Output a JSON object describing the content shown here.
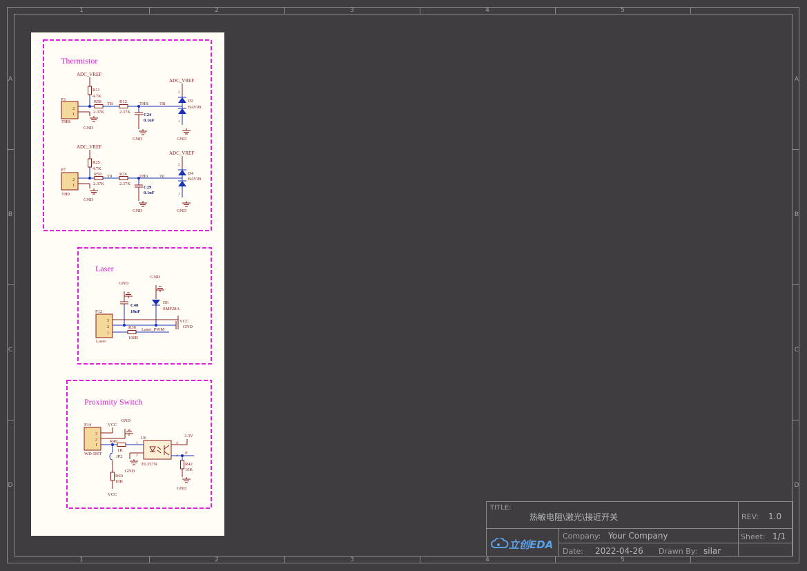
{
  "zones": {
    "columns": [
      "1",
      "2",
      "3",
      "4",
      "5"
    ],
    "rows": [
      "A",
      "B",
      "C",
      "D"
    ]
  },
  "sections": {
    "thermistor": "Thermistor",
    "laser": "Laser",
    "proximity": "Proximity Switch"
  },
  "thermistor": {
    "vref": "ADC_VREF",
    "gnd": "GND",
    "ch_b": {
      "connector_ref": "P3",
      "connector_name": "THB",
      "pins": [
        "2",
        "1"
      ],
      "r_pull_ref": "R11",
      "r_pull_val": "4.7K",
      "r_a_ref": "R58",
      "r_a_val": "2.37K",
      "net_a": "TB",
      "r_b_ref": "R12",
      "r_b_val": "2.37K",
      "net_b": "THB",
      "cap_ref": "C24",
      "cap_val": "0.1uF",
      "diode_net": "TB",
      "diode_ref": "D2",
      "diode_val": "BAV99",
      "diode_pins": [
        "2",
        "1"
      ]
    },
    "ch_0": {
      "connector_ref": "P7",
      "connector_name": "TH0",
      "pins": [
        "2",
        "1"
      ],
      "r_pull_ref": "R25",
      "r_pull_val": "4.7K",
      "r_a_ref": "R59",
      "r_a_val": "2.37K",
      "net_a": "T0",
      "r_b_ref": "R26",
      "r_b_val": "2.37K",
      "net_b": "TH0",
      "cap_ref": "C29",
      "cap_val": "0.1uF",
      "diode_net": "T0",
      "diode_ref": "D4",
      "diode_val": "BAV99",
      "diode_pins": [
        "2",
        "1"
      ]
    }
  },
  "laser": {
    "gnd": "GND",
    "cap_ref": "C40",
    "cap_val": "10uF",
    "diode_ref": "D6",
    "diode_val": "SMF28A",
    "connector_ref": "P12",
    "connector_name": "Laser",
    "pins": [
      "3",
      "2",
      "1"
    ],
    "res_ref": "R38",
    "res_val": "100R",
    "net_vcc": "VCC",
    "net_gnd": "GND",
    "net_pwm": "Laser_PWM"
  },
  "proximity": {
    "gnd": "GND",
    "vcc": "VCC",
    "connector_ref": "P14",
    "connector_name": "WD-DET",
    "pins": [
      "3",
      "2",
      "1"
    ],
    "res_in_ref": "R49",
    "res_in_val": "1K",
    "jumper_ref": "JP2",
    "res_pd_ref": "R60",
    "res_pd_val": "10K",
    "opto_ref": "U6",
    "opto_val": "EL357N",
    "opto_pins": [
      "1",
      "2",
      "3",
      "4"
    ],
    "net_3v3": "3.3V",
    "net_p": "P",
    "res_out_ref": "R42",
    "res_out_val": "10K"
  },
  "title_block": {
    "title_label": "TITLE:",
    "title": "热敏电阻\\激光\\接近开关",
    "rev_label": "REV:",
    "rev": "1.0",
    "logo_text": "立创EDA",
    "company_label": "Company:",
    "company": "Your Company",
    "sheet_label": "Sheet:",
    "sheet": "1/1",
    "date_label": "Date:",
    "date": "2022-04-26",
    "drawn_label": "Drawn By:",
    "drawn_by": "silar"
  },
  "colors": {
    "background": "#3f3d40",
    "sheet": "#fffdf6",
    "frame": "#8a8a8a",
    "wire": "#1a2fb8",
    "part": "#8b1a1a",
    "box": "#e020e0",
    "body_fill": "#f5d99a",
    "accent_logo": "#5aa0e6"
  }
}
